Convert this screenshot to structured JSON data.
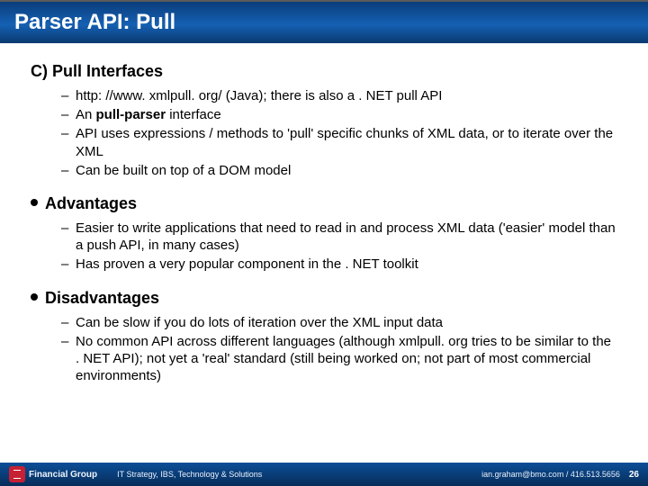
{
  "title": "Parser API: Pull",
  "sections": [
    {
      "heading": "C) Pull Interfaces",
      "dot": false,
      "items": [
        {
          "pre": "http: //www. xmlpull. org/ (Java); there is also  a . NET pull API"
        },
        {
          "pre": "An ",
          "bold": "pull-parser",
          "post": " interface"
        },
        {
          "pre": "API uses expressions / methods to 'pull' specific chunks of XML data, or to iterate over the XML"
        },
        {
          "pre": "Can be built on top of a DOM model"
        }
      ]
    },
    {
      "heading": "Advantages",
      "dot": true,
      "items": [
        {
          "pre": "Easier to write applications that need to read in and process XML data ('easier' model than a push API, in many cases)"
        },
        {
          "pre": "Has proven a very popular component in  the . NET toolkit"
        }
      ]
    },
    {
      "heading": "Disadvantages",
      "dot": true,
      "items": [
        {
          "pre": "Can be slow if you do lots of iteration over the XML input data"
        },
        {
          "pre": "No common API across different languages (although xmlpull. org tries to be similar to the . NET API); not yet a 'real' standard (still being worked on; not part of most commercial environments)"
        }
      ]
    }
  ],
  "footer": {
    "logo_text": "Financial Group",
    "center": "IT Strategy, IBS, Technology & Solutions",
    "right": "ian.graham@bmo.com / 416.513.5656",
    "page": "26"
  }
}
